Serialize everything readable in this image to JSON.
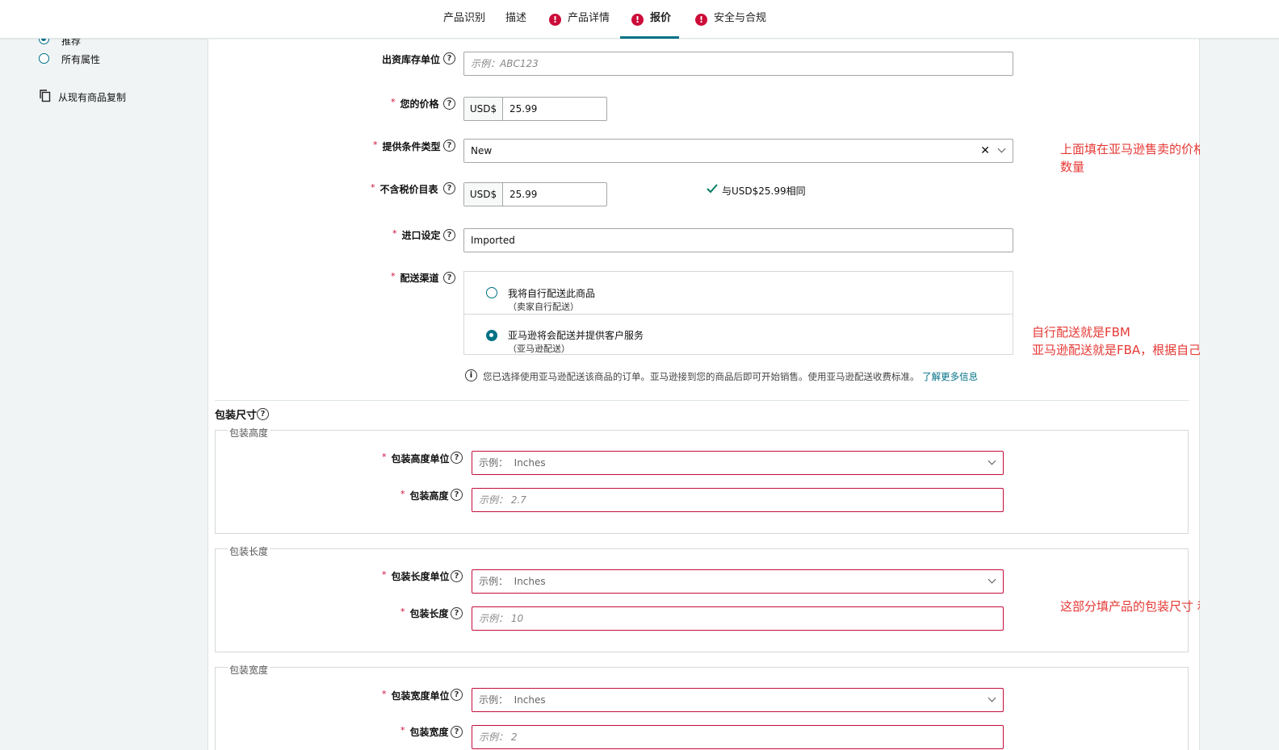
{
  "tabs": [
    {
      "label": "产品识别",
      "error": false,
      "active": false
    },
    {
      "label": "描述",
      "error": false,
      "active": false
    },
    {
      "label": "产品详情",
      "error": true,
      "active": false
    },
    {
      "label": "报价",
      "error": true,
      "active": true
    },
    {
      "label": "安全与合规",
      "error": true,
      "active": false
    }
  ],
  "left_panel": {
    "recommended": "推荐",
    "all_attributes": "所有属性",
    "copy_existing": "从现有商品复制"
  },
  "form": {
    "sku": {
      "label": "出资库存单位",
      "placeholder": "示例：ABC123"
    },
    "price": {
      "label": "您的价格",
      "currency": "USD$",
      "value": "25.99"
    },
    "condition": {
      "label": "提供条件类型",
      "value": "New"
    },
    "list_price": {
      "label": "不含税价目表",
      "currency": "USD$",
      "value": "25.99",
      "match_text": "与USD$25.99相同"
    },
    "import": {
      "label": "进口设定",
      "value": "Imported"
    },
    "shipping": {
      "label": "配送渠道",
      "options": [
        {
          "title": "我将自行配送此商品",
          "sub": "（卖家自行配送）",
          "selected": false
        },
        {
          "title": "亚马逊将会配送并提供客户服务",
          "sub": "（亚马逊配送）",
          "selected": true
        }
      ],
      "note": "您已选择使用亚马逊配送该商品的订单。亚马逊接到您的商品后即可开始销售。使用亚马逊配送收费标准。",
      "learn_more": "了解更多信息"
    },
    "package": {
      "title": "包装尺寸",
      "groups": [
        {
          "legend": "包装高度",
          "unit_label": "包装高度单位",
          "unit_placeholder_prefix": "示例：",
          "unit_placeholder_value": "Inches",
          "value_label": "包装高度",
          "value_placeholder": "示例：  2.7"
        },
        {
          "legend": "包装长度",
          "unit_label": "包装长度单位",
          "unit_placeholder_prefix": "示例：",
          "unit_placeholder_value": "Inches",
          "value_label": "包装长度",
          "value_placeholder": "示例：  10"
        },
        {
          "legend": "包装宽度",
          "unit_label": "包装宽度单位",
          "unit_placeholder_prefix": "示例：",
          "unit_placeholder_value": "Inches",
          "value_label": "包装宽度",
          "value_placeholder": "示例：  2"
        }
      ]
    }
  },
  "annotations": {
    "price": "上面填在亚马逊售卖的价格，以及库存数量",
    "shipping_line1": "自行配送就是FBM",
    "shipping_line2": "亚马逊配送就是FBA，根据自己选择",
    "package": "这部分填产品的包装尺寸 和重量"
  },
  "colors": {
    "accent": "#007185",
    "error": "#cc0c39",
    "annotation": "#e53935"
  }
}
